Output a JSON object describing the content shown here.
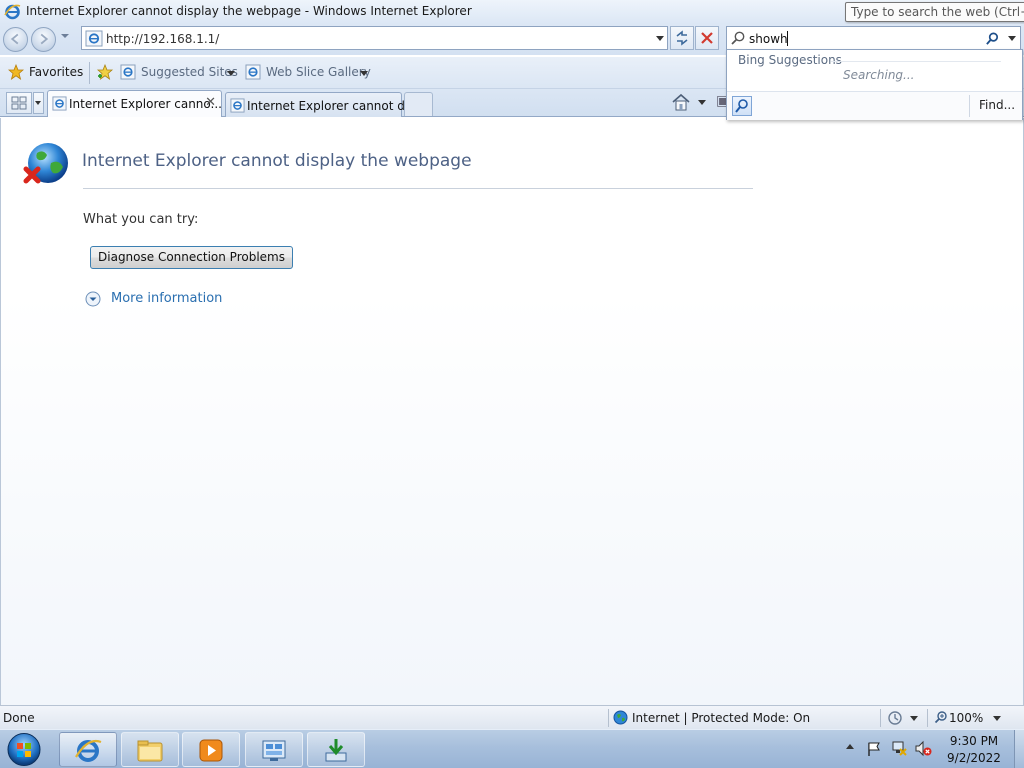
{
  "window": {
    "title": "Internet Explorer cannot display the webpage - Windows Internet Explorer",
    "tooltip": "Type to search the web (Ctrl+E)"
  },
  "address_bar": {
    "url": "http://192.168.1.1/"
  },
  "search_box": {
    "value": "showh"
  },
  "favorites_bar": {
    "favorites_label": "Favorites",
    "suggested_sites_label": "Suggested Sites",
    "web_slice_gallery_label": "Web Slice Gallery"
  },
  "tabs": [
    {
      "label": "Internet Explorer canno...",
      "active": true,
      "close_label": "✕"
    },
    {
      "label": "Internet Explorer cannot di...",
      "active": false
    }
  ],
  "search_suggestions": {
    "header": "Bing Suggestions",
    "status": "Searching...",
    "find_label": "Find..."
  },
  "error_page": {
    "title": "Internet Explorer cannot display the webpage",
    "try_label": "What you can try:",
    "diagnose_button": "Diagnose Connection Problems",
    "more_info_link": "More information"
  },
  "status_bar": {
    "status": "Done",
    "zone": "Internet | Protected Mode: On",
    "zoom": "100%"
  },
  "taskbar": {
    "time": "9:30 PM",
    "date": "9/2/2022",
    "apps": [
      "internet-explorer",
      "windows-explorer",
      "media-player",
      "control-panel",
      "installer"
    ]
  },
  "colors": {
    "title_text": "#4d6185",
    "link": "#2a6fb0",
    "chrome_top": "#dce7f5",
    "taskbar": "#a7bfdc"
  }
}
